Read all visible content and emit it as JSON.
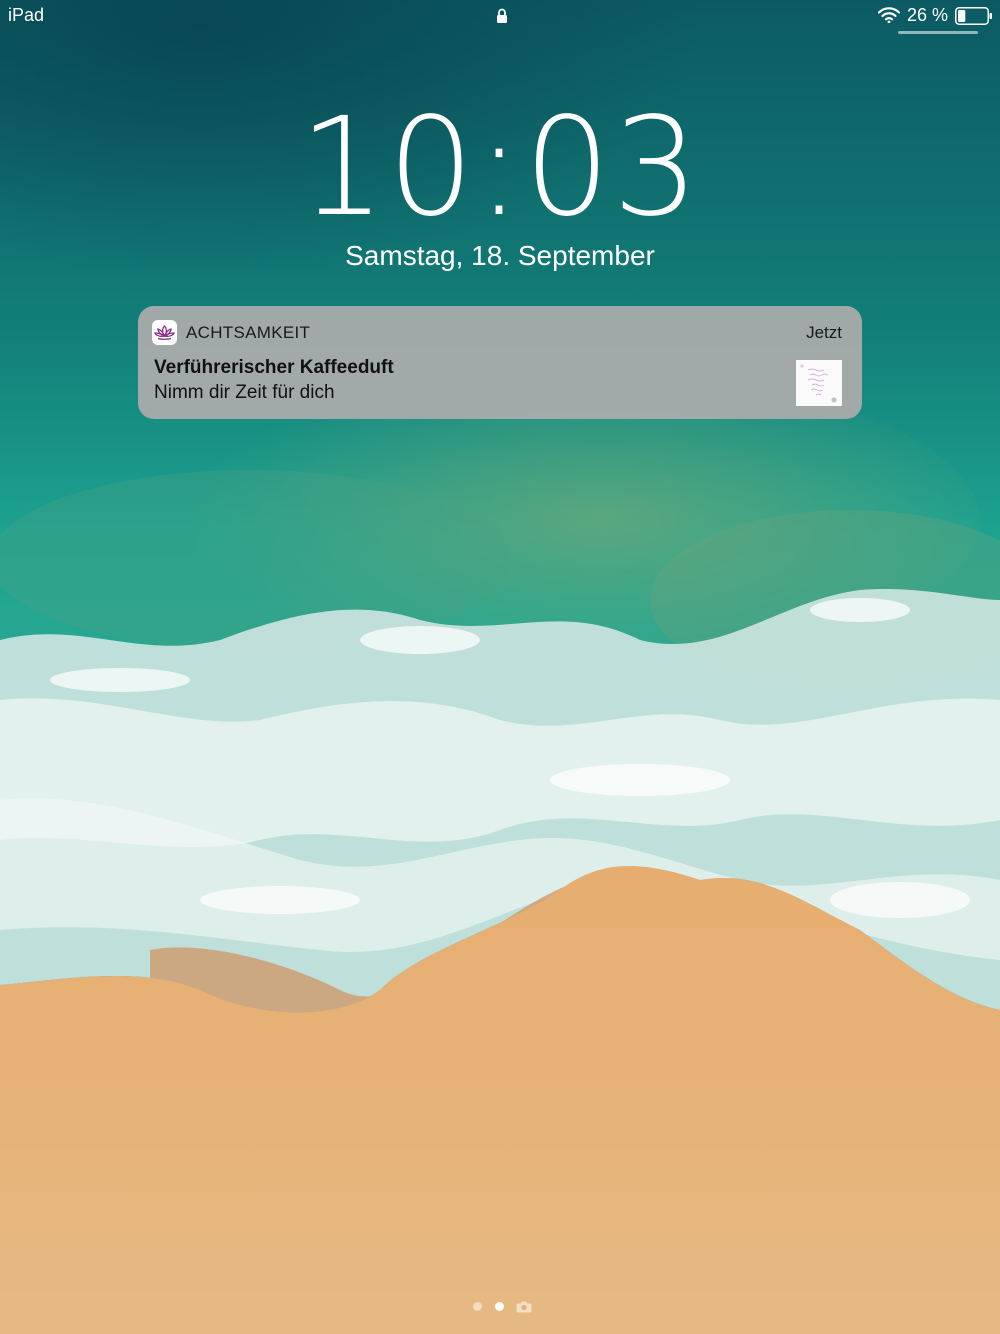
{
  "status_bar": {
    "device_name": "iPad",
    "battery_percent": "26 %",
    "battery_level": 0.26,
    "icons": [
      "lock-icon",
      "wifi-icon",
      "battery-icon"
    ]
  },
  "lock_screen": {
    "time": "10:03",
    "date": "Samstag, 18. September"
  },
  "notification": {
    "app_name": "ACHTSAMKEIT",
    "time": "Jetzt",
    "title": "Verführerischer Kaffeeduft",
    "body": "Nimm dir Zeit für dich",
    "app_icon": "lotus-icon",
    "thumbnail": "quote-card-thumbnail"
  },
  "page_indicator": {
    "pages": 3,
    "current_page": 2,
    "last_page_icon": "camera-icon"
  },
  "colors": {
    "ocean_deep": "#0f6b6a",
    "ocean_teal": "#1ea596",
    "surf": "#e8f0ef",
    "sand": "#e8b47a",
    "notification_bg": "#acacac",
    "lotus_purple": "#8a2f88"
  }
}
